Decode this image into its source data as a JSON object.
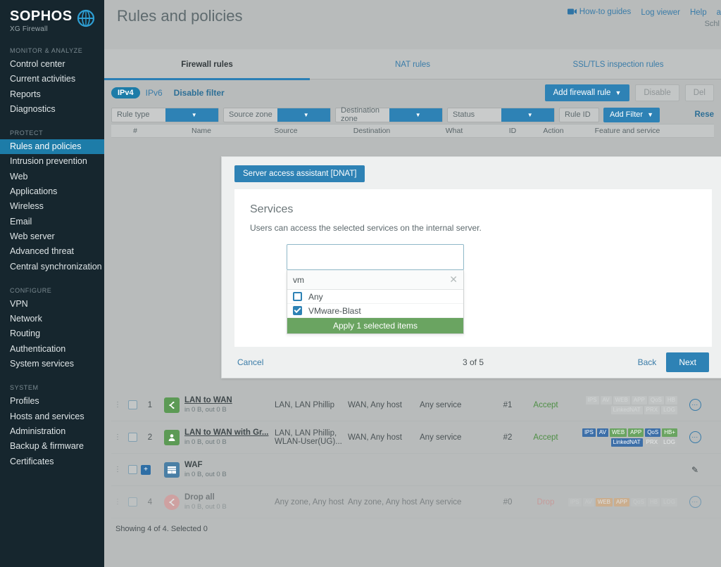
{
  "brand": {
    "name": "SOPHOS",
    "product": "XG Firewall",
    "logo_icon": "sophos-globe-icon"
  },
  "sidebar": {
    "groups": [
      {
        "title": "MONITOR & ANALYZE",
        "items": [
          {
            "label": "Control center",
            "active": false
          },
          {
            "label": "Current activities",
            "active": false
          },
          {
            "label": "Reports",
            "active": false
          },
          {
            "label": "Diagnostics",
            "active": false
          }
        ]
      },
      {
        "title": "PROTECT",
        "items": [
          {
            "label": "Rules and policies",
            "active": true
          },
          {
            "label": "Intrusion prevention",
            "active": false
          },
          {
            "label": "Web",
            "active": false
          },
          {
            "label": "Applications",
            "active": false
          },
          {
            "label": "Wireless",
            "active": false
          },
          {
            "label": "Email",
            "active": false
          },
          {
            "label": "Web server",
            "active": false
          },
          {
            "label": "Advanced threat",
            "active": false
          },
          {
            "label": "Central synchronization",
            "active": false
          }
        ]
      },
      {
        "title": "CONFIGURE",
        "items": [
          {
            "label": "VPN",
            "active": false
          },
          {
            "label": "Network",
            "active": false
          },
          {
            "label": "Routing",
            "active": false
          },
          {
            "label": "Authentication",
            "active": false
          },
          {
            "label": "System services",
            "active": false
          }
        ]
      },
      {
        "title": "SYSTEM",
        "items": [
          {
            "label": "Profiles",
            "active": false
          },
          {
            "label": "Hosts and services",
            "active": false
          },
          {
            "label": "Administration",
            "active": false
          },
          {
            "label": "Backup & firmware",
            "active": false
          },
          {
            "label": "Certificates",
            "active": false
          }
        ]
      }
    ]
  },
  "header": {
    "title": "Rules and policies",
    "links": [
      {
        "label": "How-to guides",
        "icon": "video-camera-icon"
      },
      {
        "label": "Log viewer",
        "icon": ""
      },
      {
        "label": "Help",
        "icon": ""
      },
      {
        "label": "a",
        "icon": ""
      }
    ],
    "user": "Schl"
  },
  "tabs": [
    {
      "label": "Firewall rules",
      "active": true
    },
    {
      "label": "NAT rules",
      "active": false
    },
    {
      "label": "SSL/TLS inspection rules",
      "active": false
    }
  ],
  "toolbar": {
    "ipv4_label": "IPv4",
    "ipv6_label": "IPv6",
    "disable_filter_label": "Disable filter",
    "add_rule_label": "Add firewall rule",
    "disable_label": "Disable",
    "delete_label": "Del"
  },
  "filters": {
    "selects": [
      {
        "label": "Rule type"
      },
      {
        "label": "Source zone"
      },
      {
        "label": "Destination zone"
      },
      {
        "label": "Status"
      }
    ],
    "rule_id_label": "Rule ID",
    "add_filter_label": "Add Filter",
    "reset_label": "Rese"
  },
  "table": {
    "columns": [
      "#",
      "Name",
      "Source",
      "Destination",
      "What",
      "ID",
      "Action",
      "Feature and service"
    ],
    "rows": [
      {
        "num": "1",
        "icon": "share-arrow-icon",
        "icon_color": "green",
        "name": "LAN to WAN",
        "traffic": "in 0 B, out 0 B",
        "source": "LAN, LAN Phillip",
        "destination": "WAN, Any host",
        "what": "Any service",
        "id": "#1",
        "action": "Accept",
        "action_kind": "accept",
        "badges": [
          {
            "label": "IPS",
            "kind": "ghost"
          },
          {
            "label": "AV",
            "kind": "ghost"
          },
          {
            "label": "WEB",
            "kind": "ghost"
          },
          {
            "label": "APP",
            "kind": "ghost"
          },
          {
            "label": "QoS",
            "kind": "ghost"
          },
          {
            "label": "HB",
            "kind": "ghost"
          },
          {
            "label": "LinkedNAT",
            "kind": "ghost"
          },
          {
            "label": "PRX",
            "kind": "ghost"
          },
          {
            "label": "LOG",
            "kind": "ghost"
          }
        ],
        "more_icon": "more-dots-icon",
        "faded": false
      },
      {
        "num": "2",
        "icon": "user-icon",
        "icon_color": "green",
        "name": "LAN to WAN with Gr...",
        "traffic": "in 0 B, out 0 B",
        "source": "LAN, LAN Phillip, WLAN-User(UG)...",
        "destination": "WAN, Any host",
        "what": "Any service",
        "id": "#2",
        "action": "Accept",
        "action_kind": "accept",
        "badges": [
          {
            "label": "IPS",
            "kind": "blue"
          },
          {
            "label": "AV",
            "kind": "blue"
          },
          {
            "label": "WEB",
            "kind": "green"
          },
          {
            "label": "APP",
            "kind": "green"
          },
          {
            "label": "QoS",
            "kind": "blue"
          },
          {
            "label": "HB+",
            "kind": "green"
          },
          {
            "label": "LinkedNAT",
            "kind": "blue"
          },
          {
            "label": "PRX",
            "kind": "gray"
          },
          {
            "label": "LOG",
            "kind": "gray"
          }
        ],
        "more_icon": "more-dots-icon",
        "faded": false
      },
      {
        "num": "",
        "icon": "waf-stack-icon",
        "icon_color": "blue",
        "name": "WAF",
        "traffic": "in 0 B, out 0 B",
        "source": "",
        "destination": "",
        "what": "",
        "id": "",
        "action": "",
        "action_kind": "",
        "badges": [],
        "more_icon": "pencil-icon",
        "faded": false
      },
      {
        "num": "4",
        "icon": "drop-arrow-icon",
        "icon_color": "red",
        "name": "Drop all",
        "traffic": "in 0 B, out 0 B",
        "source": "Any zone, Any host",
        "destination": "Any zone, Any host",
        "what": "Any service",
        "id": "#0",
        "action": "Drop",
        "action_kind": "drop",
        "badges": [
          {
            "label": "IPS",
            "kind": "ghost"
          },
          {
            "label": "AV",
            "kind": "ghost"
          },
          {
            "label": "WEB",
            "kind": "orange"
          },
          {
            "label": "APP",
            "kind": "orange"
          },
          {
            "label": "QoS",
            "kind": "ghost"
          },
          {
            "label": "HB",
            "kind": "ghost"
          },
          {
            "label": "LOG",
            "kind": "ghost"
          }
        ],
        "more_icon": "more-dots-icon",
        "faded": true
      }
    ],
    "footer": "Showing 4 of 4. Selected 0"
  },
  "wizard": {
    "tab_label": "Server access assistant [DNAT]",
    "heading": "Services",
    "description": "Users can access the selected services on the internal server.",
    "combo": {
      "input_value": "",
      "search_value": "vm",
      "clear_icon": "clear-x-icon",
      "options": [
        {
          "label": "Any",
          "checked": false
        },
        {
          "label": "VMware-Blast",
          "checked": true
        }
      ],
      "apply_label": "Apply 1 selected items"
    },
    "cancel_label": "Cancel",
    "steps_label": "3 of 5",
    "back_label": "Back",
    "next_label": "Next"
  },
  "colors": {
    "brand_dark": "#16262e",
    "accent_blue": "#2e82b5",
    "active_nav": "#1d7ca8",
    "apply_green": "#6aa461",
    "accept_green": "#4f8f46",
    "drop_red": "#d0807e"
  }
}
